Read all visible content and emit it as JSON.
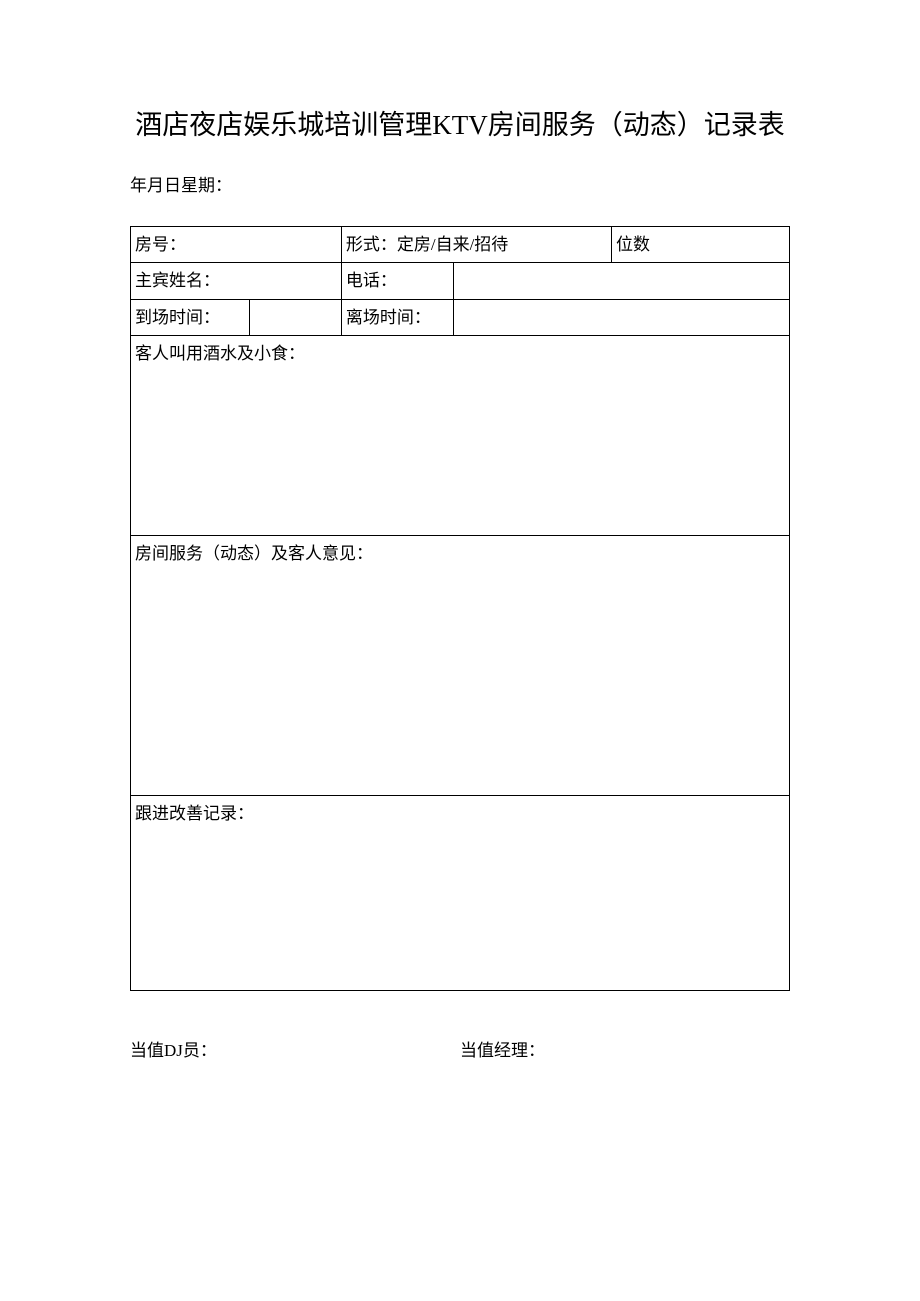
{
  "title": "酒店夜店娱乐城培训管理KTV房间服务（动态）记录表",
  "dateLine": "年月日星期：",
  "row1": {
    "roomLabel": "房号：",
    "typeLabel": "形式：定房/自来/招待",
    "seatsLabel": "位数"
  },
  "row2": {
    "guestNameLabel": "主宾姓名：",
    "phoneLabel": "电话："
  },
  "row3": {
    "arriveLabel": "到场时间：",
    "leaveLabel": "离场时间："
  },
  "section1Label": "客人叫用酒水及小食：",
  "section2Label": "房间服务（动态）及客人意见：",
  "section3Label": "跟进改善记录：",
  "footer": {
    "djLabel": "当值DJ员：",
    "managerLabel": "当值经理："
  }
}
